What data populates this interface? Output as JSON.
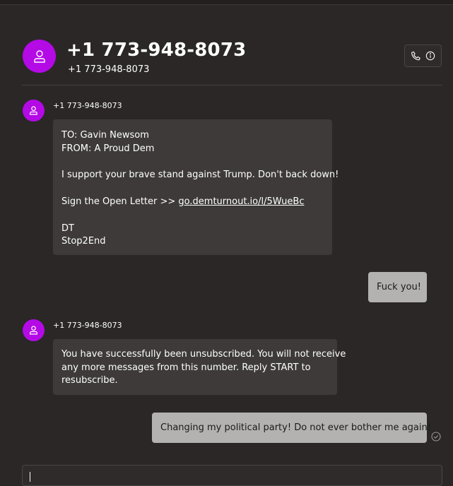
{
  "header": {
    "title": "+1 773-948-8073",
    "subtitle": "+1 773-948-8073",
    "actions": [
      "phone-icon",
      "info-icon"
    ]
  },
  "avatar_icon": "person-icon",
  "avatar_color": "#b40ae6",
  "messages": [
    {
      "direction": "incoming",
      "sender": "+1 773-948-8073",
      "lines": [
        "TO: Gavin Newsom",
        "FROM: A Proud Dem",
        "",
        "I support your brave stand against Trump. Don't back down!",
        "",
        "Sign the Open Letter >> ",
        "",
        "DT",
        "Stop2End"
      ],
      "link_text": "go.demturnout.io/l/5WueBc"
    },
    {
      "direction": "outgoing",
      "text": "Fuck you!"
    },
    {
      "direction": "incoming",
      "sender": "+1 773-948-8073",
      "lines": [
        "You have successfully been unsubscribed. You will not receive",
        "any more messages from this number. Reply START to",
        "resubscribe."
      ]
    },
    {
      "direction": "outgoing",
      "text": "Changing my political party!  Do not ever bother me again!",
      "status_icon": "check-circle-icon"
    }
  ],
  "compose": {
    "placeholder": ""
  }
}
